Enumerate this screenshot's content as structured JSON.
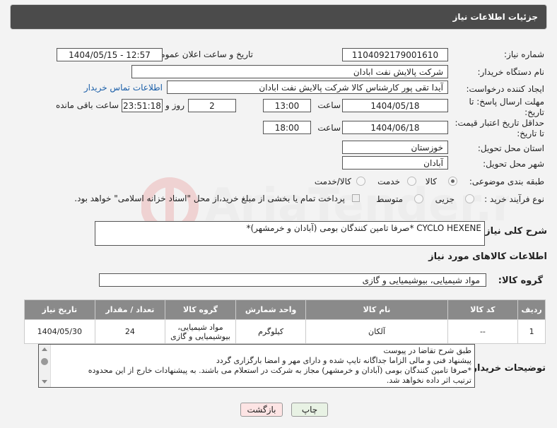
{
  "header": {
    "title": "جزئیات اطلاعات نیاز"
  },
  "form": {
    "need_number_label": "شماره نیاز:",
    "need_number": "1104092179001610",
    "announce_label": "تاریخ و ساعت اعلان عمومی:",
    "announce_value": "1404/05/15 - 12:57",
    "buyer_org_label": "نام دستگاه خریدار:",
    "buyer_org": "شرکت پالایش نفت ابادان",
    "creator_label": "ایجاد کننده درخواست:",
    "creator": "آیدا تقی پور کارشناس کالا شرکت پالایش نفت ابادان",
    "contact_link": "اطلاعات تماس خریدار",
    "reply_deadline_label_1": "مهلت ارسال پاسخ: تا",
    "reply_deadline_label_2": "تاریخ:",
    "reply_date": "1404/05/18",
    "time_label": "ساعت",
    "reply_time": "13:00",
    "days_value": "2",
    "days_label": "روز و",
    "remaining_time": "23:51:18",
    "remaining_label": "ساعت باقی مانده",
    "price_deadline_label_1": "حداقل تاریخ اعتبار قیمت:",
    "price_deadline_label_2": "تا تاریخ:",
    "price_date": "1404/06/18",
    "price_time": "18:00",
    "province_label": "استان محل تحویل:",
    "province": "خوزستان",
    "city_label": "شهر محل تحویل:",
    "city": "آبادان",
    "category_label": "طبقه بندی موضوعی:",
    "category_options": [
      "کالا",
      "خدمت",
      "کالا/خدمت"
    ],
    "purchase_type_label": "نوع فرآیند خرید :",
    "purchase_options": [
      "جزیی",
      "متوسط"
    ],
    "payment_note": "پرداخت تمام یا بخشی از مبلغ خرید،از محل \"اسناد خزانه اسلامی\" خواهد بود.",
    "summary_label": "شرح کلی نیاز:",
    "summary": "CYCLO HEXENE *صرفا تامین کنندگان بومی (آبادان و خرمشهر)*",
    "goods_info_title": "اطلاعات کالاهای مورد نیاز",
    "goods_group_label": "گروه کالا:",
    "goods_group": "مواد شیمیایی، بیوشیمیایی و  گازی"
  },
  "table": {
    "headers": [
      "ردیف",
      "کد کالا",
      "نام کالا",
      "واحد شمارش",
      "گروه کالا",
      "تعداد / مقدار",
      "تاریخ نیاز"
    ],
    "rows": [
      [
        "1",
        "--",
        "آلکان",
        "کیلوگرم",
        "مواد شیمیایی، بیوشیمیایی و گازی",
        "24",
        "1404/05/30"
      ]
    ]
  },
  "notes": {
    "label": "توضیحات خریدار:",
    "lines": [
      "طبق شرح تقاضا در پیوست",
      "پیشنهاد فنی و مالی الزاما جداگانه تایپ شده و دارای مهر و امضا بارگزاری گردد",
      "*صرفا تامین کنندگان بومی (آبادان و خرمشهر) مجاز به شرکت در استعلام می باشند. به پیشنهادات خارج از این محدوده",
      "ترتیب اثر داده نخواهد شد."
    ]
  },
  "buttons": {
    "print": "چاپ",
    "back": "بازگشت"
  },
  "colors": {
    "header_bg": "#4b4b4b",
    "link": "#1a5ea8",
    "back_btn": "#fde4e4"
  }
}
